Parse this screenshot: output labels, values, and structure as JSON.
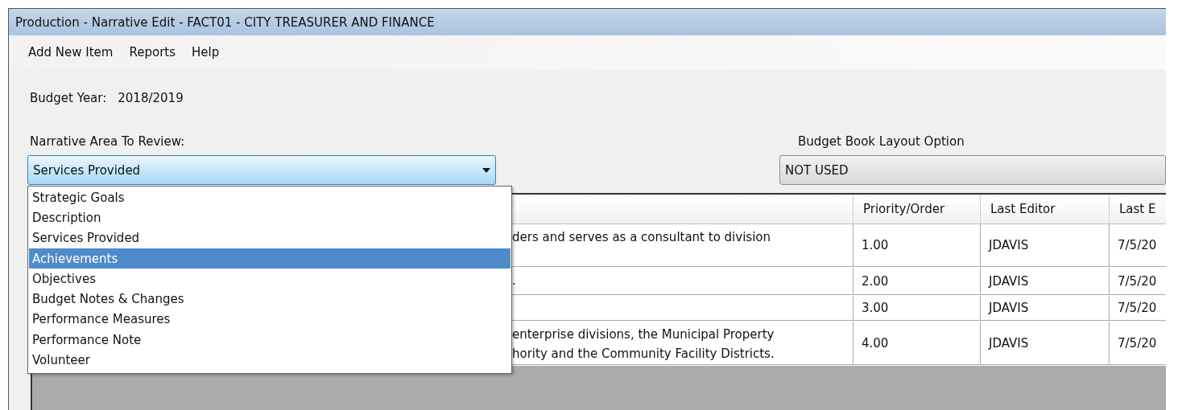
{
  "window": {
    "title": "Production - Narrative Edit - FACT01 - CITY TREASURER AND FINANCE"
  },
  "menu": [
    "Add New Item",
    "Reports",
    "Help"
  ],
  "budget_year": {
    "label": "Budget Year:",
    "value": "2018/2019"
  },
  "narrative_area": {
    "label": "Narrative Area To Review:",
    "value": "Services Provided",
    "expanded": true,
    "options": [
      {
        "label": "Strategic Goals",
        "highlighted": false
      },
      {
        "label": "Description",
        "highlighted": false
      },
      {
        "label": "Services Provided",
        "highlighted": false
      },
      {
        "label": "Achievements",
        "highlighted": true
      },
      {
        "label": "Objectives",
        "highlighted": false
      },
      {
        "label": "Budget Notes & Changes",
        "highlighted": false
      },
      {
        "label": "Performance Measures",
        "highlighted": false
      },
      {
        "label": "Performance Note",
        "highlighted": false
      },
      {
        "label": "Volunteer",
        "highlighted": false
      }
    ]
  },
  "layout_option": {
    "label": "Budget Book Layout Option",
    "value": "NOT USED"
  },
  "table": {
    "columns": [
      "Priority/Order",
      "Last Editor",
      "Last E"
    ],
    "rows": [
      {
        "description": "ders and serves as a consultant to division",
        "priority": "1.00",
        "editor": "JDAVIS",
        "date": "7/5/20"
      },
      {
        "description": ".",
        "priority": "2.00",
        "editor": "JDAVIS",
        "date": "7/5/20"
      },
      {
        "priority": "3.00",
        "editor": "JDAVIS",
        "date": "7/5/20"
      },
      {
        "description": "enterprise divisions, the Municipal Property\nhority and the Community Facility Districts.",
        "priority": "4.00",
        "editor": "JDAVIS",
        "date": "7/5/20"
      }
    ]
  }
}
